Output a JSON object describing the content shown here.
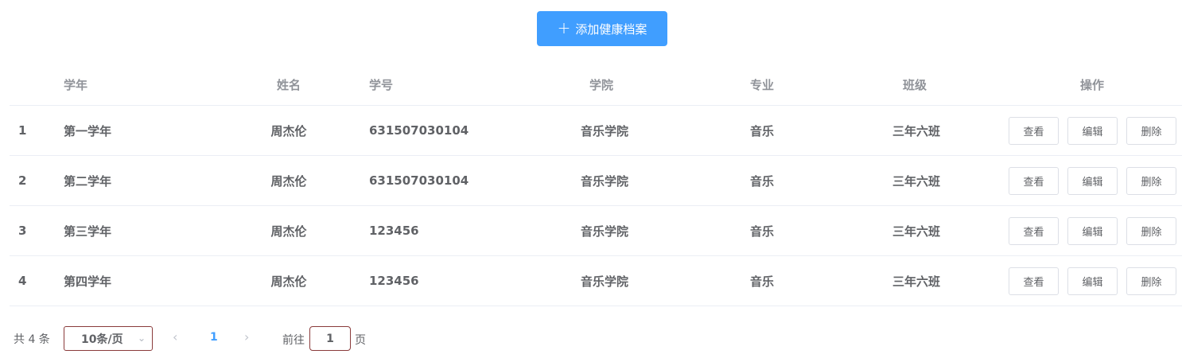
{
  "toolbar": {
    "add_label": "添加健康档案",
    "add_icon": "plus-icon"
  },
  "table": {
    "headers": {
      "year": "学年",
      "name": "姓名",
      "student_id": "学号",
      "college": "学院",
      "major": "专业",
      "class": "班级",
      "ops": "操作"
    },
    "rows": [
      {
        "index": "1",
        "year": "第一学年",
        "name": "周杰伦",
        "student_id": "631507030104",
        "college": "音乐学院",
        "major": "音乐",
        "class": "三年六班"
      },
      {
        "index": "2",
        "year": "第二学年",
        "name": "周杰伦",
        "student_id": "631507030104",
        "college": "音乐学院",
        "major": "音乐",
        "class": "三年六班"
      },
      {
        "index": "3",
        "year": "第三学年",
        "name": "周杰伦",
        "student_id": "123456",
        "college": "音乐学院",
        "major": "音乐",
        "class": "三年六班"
      },
      {
        "index": "4",
        "year": "第四学年",
        "name": "周杰伦",
        "student_id": "123456",
        "college": "音乐学院",
        "major": "音乐",
        "class": "三年六班"
      }
    ],
    "actions": {
      "view": "查看",
      "edit": "编辑",
      "delete": "删除"
    }
  },
  "pagination": {
    "total_text": "共 4 条",
    "page_size": "10条/页",
    "current_page": "1",
    "goto_label": "前往",
    "goto_value": "1",
    "page_suffix": "页"
  },
  "colors": {
    "primary": "#409eff",
    "border": "#ebeef5",
    "text": "#606266",
    "header_text": "#909399"
  }
}
